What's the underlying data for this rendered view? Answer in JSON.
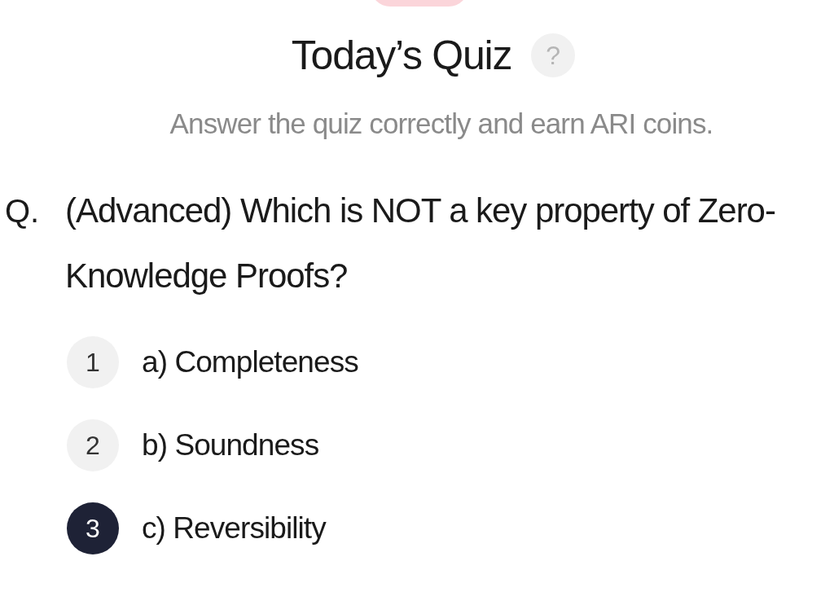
{
  "title": "Today’s Quiz",
  "help": {
    "label": "?"
  },
  "subtitle": "Answer the quiz correctly and earn ARI coins.",
  "question": {
    "prefix": "Q.",
    "text": "(Advanced) Which is NOT a key property of Zero-Knowledge Proofs?"
  },
  "options": [
    {
      "number": "1",
      "label": "a) Completeness",
      "selected": false
    },
    {
      "number": "2",
      "label": "b) Soundness",
      "selected": false
    },
    {
      "number": "3",
      "label": "c) Reversibility",
      "selected": true
    }
  ]
}
